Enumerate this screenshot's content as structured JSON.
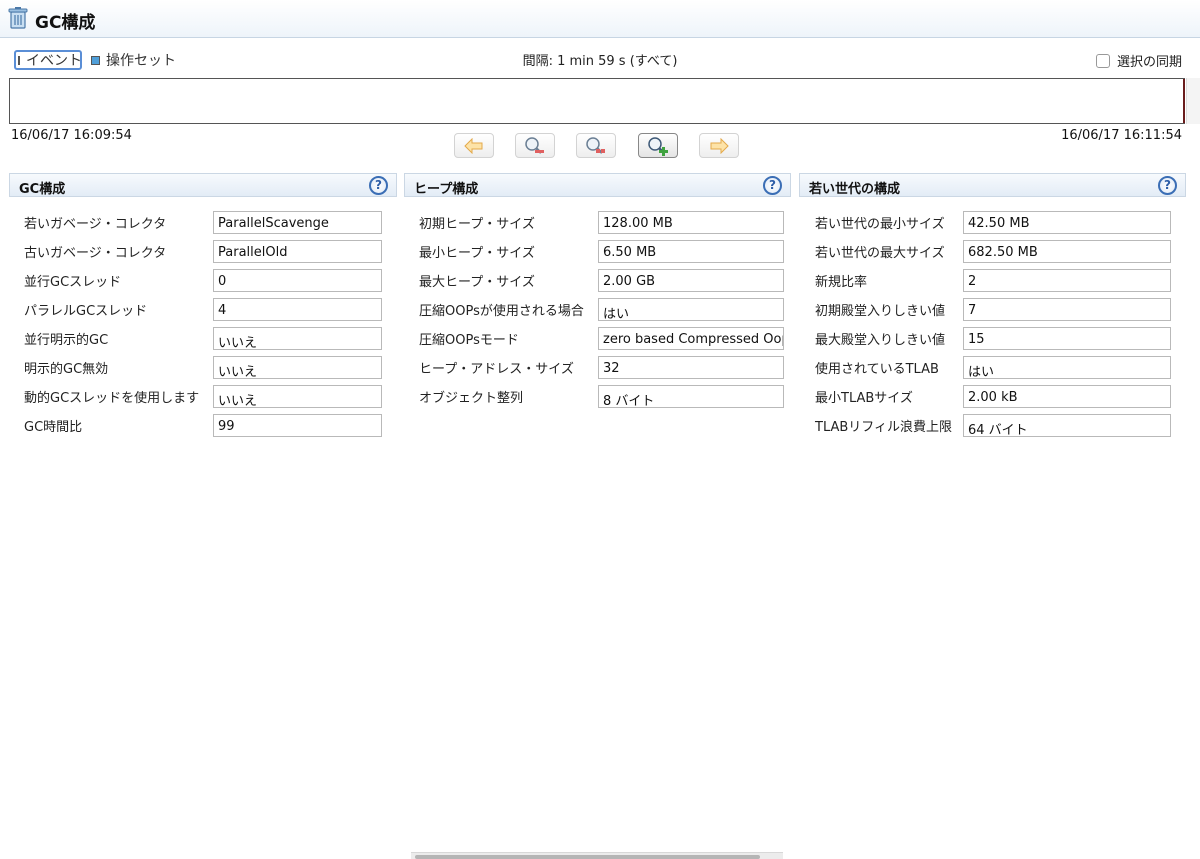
{
  "title": {
    "text": "GC構成",
    "icon": "trash-can-icon"
  },
  "toolbar": {
    "events_label": "イベント",
    "events_color": "#d9402a",
    "opsets_label": "操作セット",
    "opsets_color": "#4f9fd9",
    "interval": "間隔: 1 min 59 s (すべて)",
    "sync_label": "選択の同期",
    "sync_checked": false
  },
  "timeline": {
    "start": "16/06/17 16:09:54",
    "end": "16/06/17 16:11:54"
  },
  "nav_buttons": [
    "back-arrow-icon",
    "zoom-out-icon",
    "zoom-reset-icon",
    "zoom-in-icon",
    "forward-arrow-icon"
  ],
  "panels": {
    "gc": {
      "title": "GC構成",
      "rows": [
        {
          "label": "若いガベージ・コレクタ",
          "value": "ParallelScavenge"
        },
        {
          "label": "古いガベージ・コレクタ",
          "value": "ParallelOld"
        },
        {
          "label": "並行GCスレッド",
          "value": "0"
        },
        {
          "label": "パラレルGCスレッド",
          "value": "4"
        },
        {
          "label": "並行明示的GC",
          "value": "いいえ"
        },
        {
          "label": "明示的GC無効",
          "value": "いいえ"
        },
        {
          "label": "動的GCスレッドを使用します",
          "value": "いいえ"
        },
        {
          "label": "GC時間比",
          "value": "99"
        }
      ]
    },
    "heap": {
      "title": "ヒープ構成",
      "rows": [
        {
          "label": "初期ヒープ・サイズ",
          "value": "128.00 MB"
        },
        {
          "label": "最小ヒープ・サイズ",
          "value": "6.50 MB"
        },
        {
          "label": "最大ヒープ・サイズ",
          "value": "2.00 GB"
        },
        {
          "label": "圧縮OOPsが使用される場合",
          "value": "はい"
        },
        {
          "label": "圧縮OOPsモード",
          "value": "zero based Compressed Oops"
        },
        {
          "label": "ヒープ・アドレス・サイズ",
          "value": "32"
        },
        {
          "label": "オブジェクト整列",
          "value": "8 バイト"
        }
      ]
    },
    "young": {
      "title": "若い世代の構成",
      "rows": [
        {
          "label": "若い世代の最小サイズ",
          "value": "42.50 MB"
        },
        {
          "label": "若い世代の最大サイズ",
          "value": "682.50 MB"
        },
        {
          "label": "新規比率",
          "value": "2"
        },
        {
          "label": "初期殿堂入りしきい値",
          "value": "7"
        },
        {
          "label": "最大殿堂入りしきい値",
          "value": "15"
        },
        {
          "label": "使用されているTLAB",
          "value": "はい"
        },
        {
          "label": "最小TLABサイズ",
          "value": "2.00 kB"
        },
        {
          "label": "TLABリフィル浪費上限",
          "value": "64 バイト"
        }
      ]
    }
  }
}
